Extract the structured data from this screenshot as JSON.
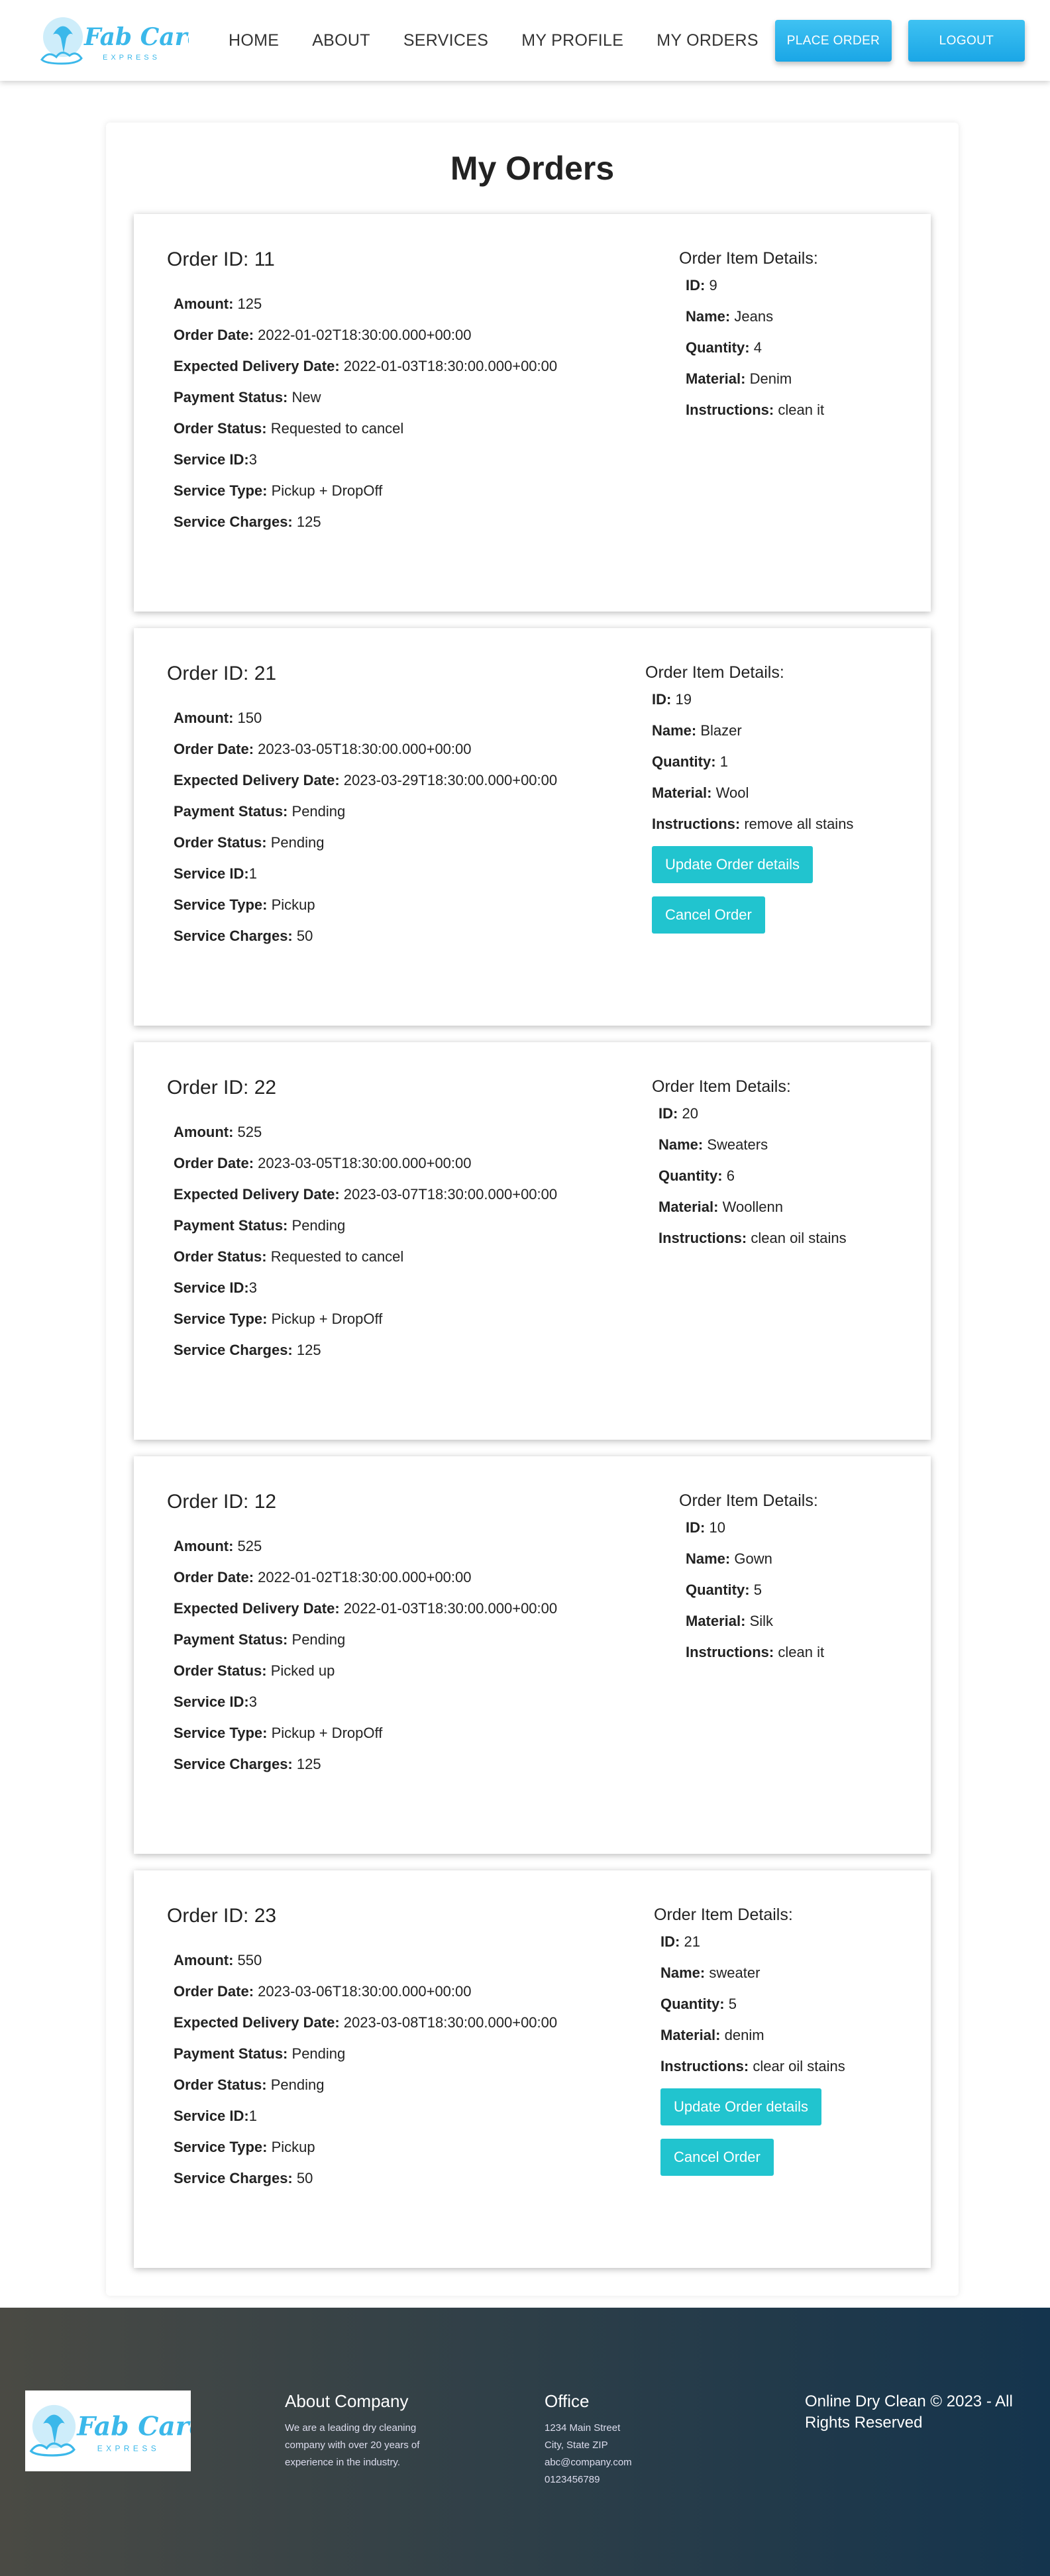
{
  "brand": {
    "name": "Fab Care",
    "tagline": "EXPRESS",
    "color": "#3bb8ea"
  },
  "nav": {
    "links": [
      "HOME",
      "ABOUT",
      "SERVICES",
      "MY PROFILE",
      "MY ORDERS"
    ],
    "place_order": "PLACE ORDER",
    "logout": "LOGOUT"
  },
  "page_title": "My Orders",
  "labels": {
    "amount": "Amount:",
    "order_date": "Order Date:",
    "expected_delivery": "Expected Delivery Date:",
    "payment_status": "Payment Status:",
    "order_status": "Order Status:",
    "service_id": "Service ID:",
    "service_type": "Service Type:",
    "service_charges": "Service Charges:",
    "item_details": "Order Item Details:",
    "item_id": "ID:",
    "item_name": "Name:",
    "item_quantity": "Quantity:",
    "item_material": "Material:",
    "item_instructions": "Instructions:"
  },
  "orders": [
    {
      "title": "Order ID: 11",
      "amount": "125",
      "order_date": "2022-01-02T18:30:00.000+00:00",
      "expected_delivery": "2022-01-03T18:30:00.000+00:00",
      "payment_status": "New",
      "order_status": "Requested to cancel",
      "service_id": "3",
      "service_type": "Pickup + DropOff",
      "service_charges": "125",
      "item": {
        "id": "9",
        "name": "Jeans",
        "quantity": "4",
        "material": "Denim",
        "instructions": "clean it"
      }
    },
    {
      "title": "Order ID: 21",
      "amount": "150",
      "order_date": "2023-03-05T18:30:00.000+00:00",
      "expected_delivery": "2023-03-29T18:30:00.000+00:00",
      "payment_status": "Pending",
      "order_status": "Pending",
      "service_id": "1",
      "service_type": "Pickup",
      "service_charges": "50",
      "item": {
        "id": "19",
        "name": "Blazer",
        "quantity": "1",
        "material": "Wool",
        "instructions": "remove all stains"
      },
      "update_label": "Update Order details",
      "cancel_label": "Cancel Order"
    },
    {
      "title": "Order ID: 22",
      "amount": "525",
      "order_date": "2023-03-05T18:30:00.000+00:00",
      "expected_delivery": "2023-03-07T18:30:00.000+00:00",
      "payment_status": "Pending",
      "order_status": "Requested to cancel",
      "service_id": "3",
      "service_type": "Pickup + DropOff",
      "service_charges": "125",
      "item": {
        "id": "20",
        "name": "Sweaters",
        "quantity": "6",
        "material": "Woollenn",
        "instructions": "clean oil stains"
      }
    },
    {
      "title": "Order ID: 12",
      "amount": "525",
      "order_date": "2022-01-02T18:30:00.000+00:00",
      "expected_delivery": "2022-01-03T18:30:00.000+00:00",
      "payment_status": "Pending",
      "order_status": "Picked up",
      "service_id": "3",
      "service_type": "Pickup + DropOff",
      "service_charges": "125",
      "item": {
        "id": "10",
        "name": "Gown",
        "quantity": "5",
        "material": "Silk",
        "instructions": "clean it"
      }
    },
    {
      "title": "Order ID: 23",
      "amount": "550",
      "order_date": "2023-03-06T18:30:00.000+00:00",
      "expected_delivery": "2023-03-08T18:30:00.000+00:00",
      "payment_status": "Pending",
      "order_status": "Pending",
      "service_id": "1",
      "service_type": "Pickup",
      "service_charges": "50",
      "item": {
        "id": "21",
        "name": "sweater",
        "quantity": "5",
        "material": "denim",
        "instructions": "clear oil stains"
      },
      "update_label": "Update Order details",
      "cancel_label": "Cancel Order"
    }
  ],
  "footer": {
    "about_title": "About Company",
    "about_lines": [
      "We are a leading dry cleaning",
      "company with over 20 years of",
      "experience in the industry."
    ],
    "office_title": "Office",
    "office_lines": [
      "1234 Main Street",
      "City, State ZIP",
      "abc@company.com",
      "0123456789"
    ],
    "copyright": "Online Dry Clean © 2023 - All Rights Reserved"
  }
}
